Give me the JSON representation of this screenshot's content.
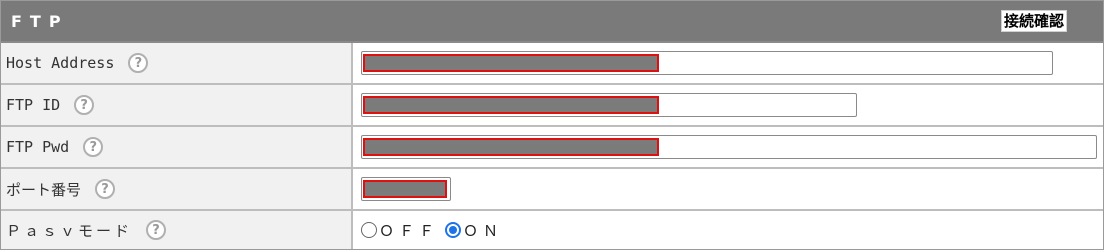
{
  "header": {
    "title": "FTP",
    "check_button": "接続確認"
  },
  "rows": [
    {
      "label": "Host Address",
      "help": "?"
    },
    {
      "label": "FTP ID",
      "help": "?"
    },
    {
      "label": "FTP Pwd",
      "help": "?"
    },
    {
      "label": "ポート番号",
      "help": "?"
    },
    {
      "label": "Ｐａｓｖモード",
      "help": "?"
    }
  ],
  "pasv_mode": {
    "options": [
      {
        "label": "ＯＦＦ",
        "selected": false
      },
      {
        "label": "ＯＮ",
        "selected": true
      }
    ]
  },
  "colors": {
    "header_bg": "#7a7a7a",
    "label_bg": "#f1f1f1",
    "redaction": "#7b7b7b",
    "redaction_border": "#e01010",
    "radio_selected": "#1e73e8"
  }
}
